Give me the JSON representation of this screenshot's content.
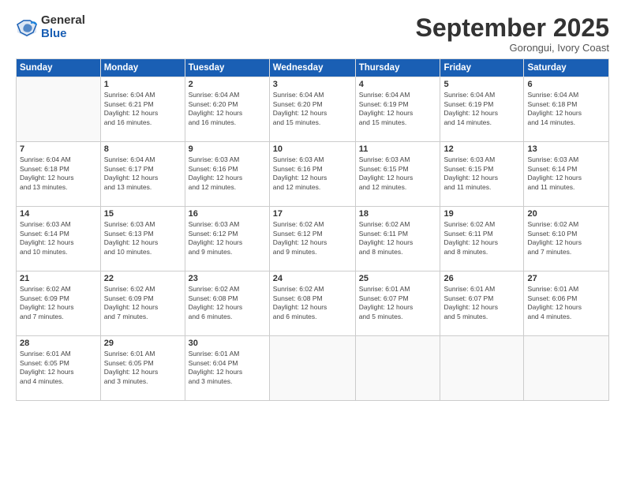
{
  "logo": {
    "general": "General",
    "blue": "Blue"
  },
  "title": "September 2025",
  "subtitle": "Gorongui, Ivory Coast",
  "header_days": [
    "Sunday",
    "Monday",
    "Tuesday",
    "Wednesday",
    "Thursday",
    "Friday",
    "Saturday"
  ],
  "weeks": [
    [
      {
        "num": "",
        "info": ""
      },
      {
        "num": "1",
        "info": "Sunrise: 6:04 AM\nSunset: 6:21 PM\nDaylight: 12 hours\nand 16 minutes."
      },
      {
        "num": "2",
        "info": "Sunrise: 6:04 AM\nSunset: 6:20 PM\nDaylight: 12 hours\nand 16 minutes."
      },
      {
        "num": "3",
        "info": "Sunrise: 6:04 AM\nSunset: 6:20 PM\nDaylight: 12 hours\nand 15 minutes."
      },
      {
        "num": "4",
        "info": "Sunrise: 6:04 AM\nSunset: 6:19 PM\nDaylight: 12 hours\nand 15 minutes."
      },
      {
        "num": "5",
        "info": "Sunrise: 6:04 AM\nSunset: 6:19 PM\nDaylight: 12 hours\nand 14 minutes."
      },
      {
        "num": "6",
        "info": "Sunrise: 6:04 AM\nSunset: 6:18 PM\nDaylight: 12 hours\nand 14 minutes."
      }
    ],
    [
      {
        "num": "7",
        "info": "Sunrise: 6:04 AM\nSunset: 6:18 PM\nDaylight: 12 hours\nand 13 minutes."
      },
      {
        "num": "8",
        "info": "Sunrise: 6:04 AM\nSunset: 6:17 PM\nDaylight: 12 hours\nand 13 minutes."
      },
      {
        "num": "9",
        "info": "Sunrise: 6:03 AM\nSunset: 6:16 PM\nDaylight: 12 hours\nand 12 minutes."
      },
      {
        "num": "10",
        "info": "Sunrise: 6:03 AM\nSunset: 6:16 PM\nDaylight: 12 hours\nand 12 minutes."
      },
      {
        "num": "11",
        "info": "Sunrise: 6:03 AM\nSunset: 6:15 PM\nDaylight: 12 hours\nand 12 minutes."
      },
      {
        "num": "12",
        "info": "Sunrise: 6:03 AM\nSunset: 6:15 PM\nDaylight: 12 hours\nand 11 minutes."
      },
      {
        "num": "13",
        "info": "Sunrise: 6:03 AM\nSunset: 6:14 PM\nDaylight: 12 hours\nand 11 minutes."
      }
    ],
    [
      {
        "num": "14",
        "info": "Sunrise: 6:03 AM\nSunset: 6:14 PM\nDaylight: 12 hours\nand 10 minutes."
      },
      {
        "num": "15",
        "info": "Sunrise: 6:03 AM\nSunset: 6:13 PM\nDaylight: 12 hours\nand 10 minutes."
      },
      {
        "num": "16",
        "info": "Sunrise: 6:03 AM\nSunset: 6:12 PM\nDaylight: 12 hours\nand 9 minutes."
      },
      {
        "num": "17",
        "info": "Sunrise: 6:02 AM\nSunset: 6:12 PM\nDaylight: 12 hours\nand 9 minutes."
      },
      {
        "num": "18",
        "info": "Sunrise: 6:02 AM\nSunset: 6:11 PM\nDaylight: 12 hours\nand 8 minutes."
      },
      {
        "num": "19",
        "info": "Sunrise: 6:02 AM\nSunset: 6:11 PM\nDaylight: 12 hours\nand 8 minutes."
      },
      {
        "num": "20",
        "info": "Sunrise: 6:02 AM\nSunset: 6:10 PM\nDaylight: 12 hours\nand 7 minutes."
      }
    ],
    [
      {
        "num": "21",
        "info": "Sunrise: 6:02 AM\nSunset: 6:09 PM\nDaylight: 12 hours\nand 7 minutes."
      },
      {
        "num": "22",
        "info": "Sunrise: 6:02 AM\nSunset: 6:09 PM\nDaylight: 12 hours\nand 7 minutes."
      },
      {
        "num": "23",
        "info": "Sunrise: 6:02 AM\nSunset: 6:08 PM\nDaylight: 12 hours\nand 6 minutes."
      },
      {
        "num": "24",
        "info": "Sunrise: 6:02 AM\nSunset: 6:08 PM\nDaylight: 12 hours\nand 6 minutes."
      },
      {
        "num": "25",
        "info": "Sunrise: 6:01 AM\nSunset: 6:07 PM\nDaylight: 12 hours\nand 5 minutes."
      },
      {
        "num": "26",
        "info": "Sunrise: 6:01 AM\nSunset: 6:07 PM\nDaylight: 12 hours\nand 5 minutes."
      },
      {
        "num": "27",
        "info": "Sunrise: 6:01 AM\nSunset: 6:06 PM\nDaylight: 12 hours\nand 4 minutes."
      }
    ],
    [
      {
        "num": "28",
        "info": "Sunrise: 6:01 AM\nSunset: 6:05 PM\nDaylight: 12 hours\nand 4 minutes."
      },
      {
        "num": "29",
        "info": "Sunrise: 6:01 AM\nSunset: 6:05 PM\nDaylight: 12 hours\nand 3 minutes."
      },
      {
        "num": "30",
        "info": "Sunrise: 6:01 AM\nSunset: 6:04 PM\nDaylight: 12 hours\nand 3 minutes."
      },
      {
        "num": "",
        "info": ""
      },
      {
        "num": "",
        "info": ""
      },
      {
        "num": "",
        "info": ""
      },
      {
        "num": "",
        "info": ""
      }
    ]
  ]
}
